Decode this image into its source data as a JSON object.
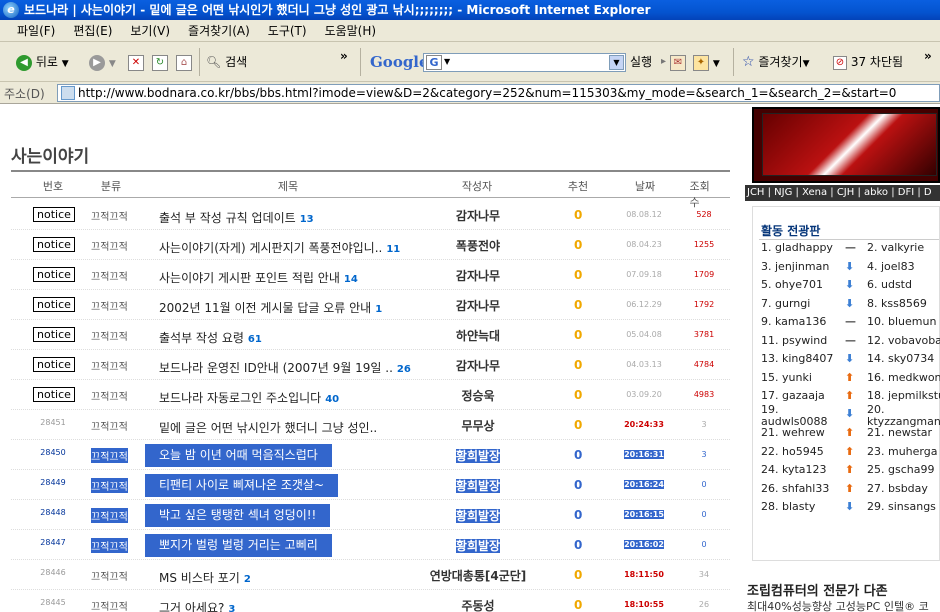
{
  "window": {
    "title": "보드나라 | 사는이야기 - 밑에 글은 어떤 낚시인가 했더니 그냥 성인 광고 낚시;;;;;;;; - Microsoft Internet Explorer"
  },
  "menu": [
    "파일(F)",
    "편집(E)",
    "보기(V)",
    "즐겨찾기(A)",
    "도구(T)",
    "도움말(H)"
  ],
  "toolbar": {
    "back": "뒤로",
    "search": "검색",
    "google": "Google",
    "go": "실행",
    "favorites": "즐겨찾기",
    "blocked": "37 차단됨",
    "more": "»"
  },
  "address": {
    "label": "주소(D)",
    "url": "http://www.bodnara.co.kr/bbs/bbs.html?imode=view&D=2&category=252&num=115303&my_mode=&search_1=&search_2=&start=0"
  },
  "board": {
    "title": "사는이야기",
    "headers": {
      "num": "번호",
      "cat": "분류",
      "subject": "제목",
      "author": "작성자",
      "rec": "추천",
      "date": "날짜",
      "views": "조회수"
    },
    "rows": [
      {
        "num": "notice",
        "notice": true,
        "cat": "끄적끄적",
        "subject": "출석 부 작성 규칙 업데이트",
        "comments": "13",
        "author": "감자나무",
        "rec": "0",
        "date": "08.08.12",
        "views": "528"
      },
      {
        "num": "notice",
        "notice": true,
        "cat": "끄적끄적",
        "subject": "사는이야기(자게) 게시판지기 폭풍전야입니..",
        "comments": "11",
        "author": "폭풍전야",
        "rec": "0",
        "date": "08.04.23",
        "views": "1255"
      },
      {
        "num": "notice",
        "notice": true,
        "cat": "끄적끄적",
        "subject": "사는이야기 게시판 포인트 적립 안내",
        "comments": "14",
        "author": "감자나무",
        "rec": "0",
        "date": "07.09.18",
        "views": "1709"
      },
      {
        "num": "notice",
        "notice": true,
        "cat": "끄적끄적",
        "subject": "2002년 11월 이전 게시물 답글 오류 안내",
        "comments": "1",
        "author": "감자나무",
        "rec": "0",
        "date": "06.12.29",
        "views": "1792"
      },
      {
        "num": "notice",
        "notice": true,
        "cat": "끄적끄적",
        "subject": "출석부 작성 요령",
        "comments": "61",
        "author": "하얀늑대",
        "rec": "0",
        "date": "05.04.08",
        "views": "3781"
      },
      {
        "num": "notice",
        "notice": true,
        "cat": "끄적끄적",
        "subject": "보드나라 운영진 ID안내 (2007년 9월 19일 ..",
        "comments": "26",
        "author": "감자나무",
        "rec": "0",
        "date": "04.03.13",
        "views": "4784"
      },
      {
        "num": "notice",
        "notice": true,
        "cat": "끄적끄적",
        "subject": "보드나라 자동로그인 주소입니다",
        "comments": "40",
        "author": "정승욱",
        "rec": "0",
        "date": "03.09.20",
        "views": "4983"
      },
      {
        "num": "28451",
        "cat": "끄적끄적",
        "subject": "밑에 글은 어떤 낚시인가 했더니 그냥 성인..",
        "comments": "",
        "author": "무무상",
        "rec": "0",
        "date": "20:24:33",
        "views": "3"
      },
      {
        "num": "28450",
        "highlight": true,
        "cat": "끄적끄적",
        "subject": "오늘 밤 이년 어때 먹음직스럽다",
        "comments": "",
        "author": "황희발장",
        "rec": "0",
        "date": "20:16:31",
        "views": "3"
      },
      {
        "num": "28449",
        "highlight": true,
        "cat": "끄적끄적",
        "subject": "티팬티 사이로 삐져나온 조갯살~",
        "comments": "",
        "author": "황희발장",
        "rec": "0",
        "date": "20:16:24",
        "views": "0"
      },
      {
        "num": "28448",
        "highlight": true,
        "cat": "끄적끄적",
        "subject": "박고 싶은 탱탱한 섹녀 엉덩이!!",
        "comments": "",
        "author": "황희발장",
        "rec": "0",
        "date": "20:16:15",
        "views": "0"
      },
      {
        "num": "28447",
        "highlight": true,
        "cat": "끄적끄적",
        "subject": "뽀지가 벌렁 벌렁 거리는 고삐리",
        "comments": "",
        "author": "황희발장",
        "rec": "0",
        "date": "20:16:02",
        "views": "0"
      },
      {
        "num": "28446",
        "cat": "끄적끄적",
        "subject": "MS 비스타 포기",
        "comments": "2",
        "author": "연방대총통[4군단]",
        "rec": "0",
        "date": "18:11:50",
        "views": "34"
      },
      {
        "num": "28445",
        "cat": "끄적끄적",
        "subject": "그거 아세요?",
        "comments": "3",
        "author": "주동성",
        "rec": "0",
        "date": "18:10:55",
        "views": "26"
      }
    ]
  },
  "sidebar": {
    "links": "JCH | NJG | Xena | CJH | abko | DFI | D",
    "ranking_title": "활동 전광판",
    "ranking": [
      {
        "l": "1. gladhappy",
        "la": "eq",
        "r": "2. valkyrie",
        "ra": "dn"
      },
      {
        "l": "3. jenjinman",
        "la": "dn",
        "r": "4. joel83",
        "ra": "dn"
      },
      {
        "l": "5. ohye701",
        "la": "dn",
        "r": "6. udstd",
        "ra": "dn"
      },
      {
        "l": "7. gurngi",
        "la": "dn",
        "r": "8. kss8569",
        "ra": "up"
      },
      {
        "l": "9. kama136",
        "la": "eq",
        "r": "10. bluemun",
        "ra": "eq"
      },
      {
        "l": "11. psywind",
        "la": "eq",
        "r": "12. vobavoba",
        "ra": "dn"
      },
      {
        "l": "13. king8407",
        "la": "dn",
        "r": "14. sky0734",
        "ra": "dn"
      },
      {
        "l": "15. yunki",
        "la": "up",
        "r": "16. medkwon",
        "ra": "up"
      },
      {
        "l": "17. gazaaja",
        "la": "up",
        "r": "18. jepmilkstu",
        "ra": "up"
      },
      {
        "l": "19.\naudwls0088",
        "la": "dn",
        "r": "20.\nktyzzangman",
        "ra": "up"
      },
      {
        "l": "21. wehrew",
        "la": "up",
        "r": "21. newstar",
        "ra": "up"
      },
      {
        "l": "22. ho5945",
        "la": "up",
        "r": "23. muherga",
        "ra": "up"
      },
      {
        "l": "24. kyta123",
        "la": "up",
        "r": "25. gscha99",
        "ra": "up"
      },
      {
        "l": "26. shfahl33",
        "la": "up",
        "r": "27. bsbday",
        "ra": "up"
      },
      {
        "l": "28. blasty",
        "la": "dn",
        "r": "29. sinsangs",
        "ra": "up"
      }
    ],
    "ad_title": "조립컴퓨터의 전문가 다존",
    "ad_sub": "최대40%성능향상 고성능PC 인텔® 코"
  },
  "colors": {
    "highlight": "#3366cc",
    "rec": "#f0a800",
    "views_red": "#cc0000"
  }
}
